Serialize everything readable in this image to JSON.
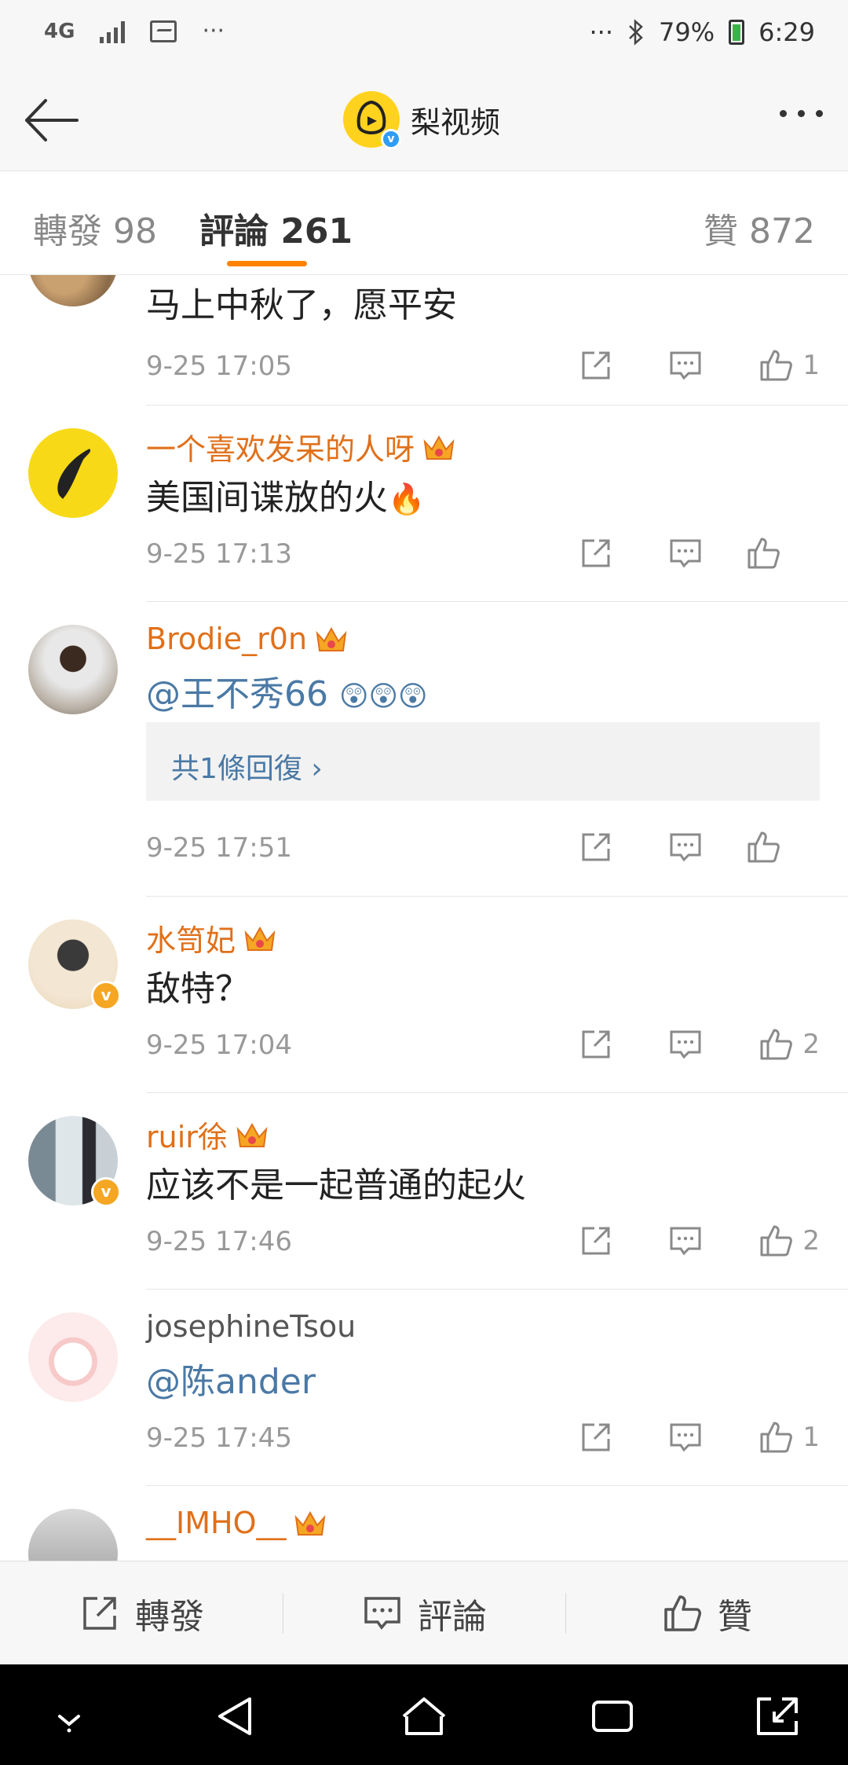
{
  "status_bar": {
    "network": "4G",
    "dots_left": "···",
    "dots_right": "···",
    "battery": "79%",
    "time": "6:29"
  },
  "header": {
    "back_icon": "back-arrow-icon",
    "title": "梨视频",
    "more_icon": "more-dots-icon"
  },
  "tabs": [
    {
      "label": "轉發 98"
    },
    {
      "label": "評論 261"
    },
    {
      "label": "贊 872"
    }
  ],
  "comments": [
    {
      "user": "",
      "text": "马上中秋了，愿平安",
      "time": "9-25 17:05",
      "likes": "1"
    },
    {
      "user": "一个喜欢发呆的人呀",
      "text": "美国间谍放的火",
      "emoji": "🔥",
      "time": "9-25 17:13",
      "likes": ""
    },
    {
      "user": "Brodie_r0n",
      "text": "@王不秀66",
      "emoji": "😲😲😲",
      "reply_summary": "共1條回復",
      "time": "9-25 17:51",
      "likes": ""
    },
    {
      "user": "水笥妃",
      "text": "敌特？",
      "time": "9-25 17:04",
      "likes": "2"
    },
    {
      "user": "ruir徐",
      "text": "应该不是一起普通的起火",
      "time": "9-25 17:46",
      "likes": "2"
    },
    {
      "user": "josephineTsou",
      "text": "@陈ander",
      "time": "9-25 17:45",
      "likes": "1"
    },
    {
      "user": "__IMHO__",
      "text": "",
      "time": "",
      "likes": ""
    }
  ],
  "bottom_bar": {
    "repost_label": "轉發",
    "comment_label": "評論",
    "like_label": "贊"
  },
  "colors": {
    "accent_orange": "#ff8200",
    "username_orange": "#e0701a",
    "link_blue": "#4a79a5",
    "time_gray": "#999999"
  }
}
